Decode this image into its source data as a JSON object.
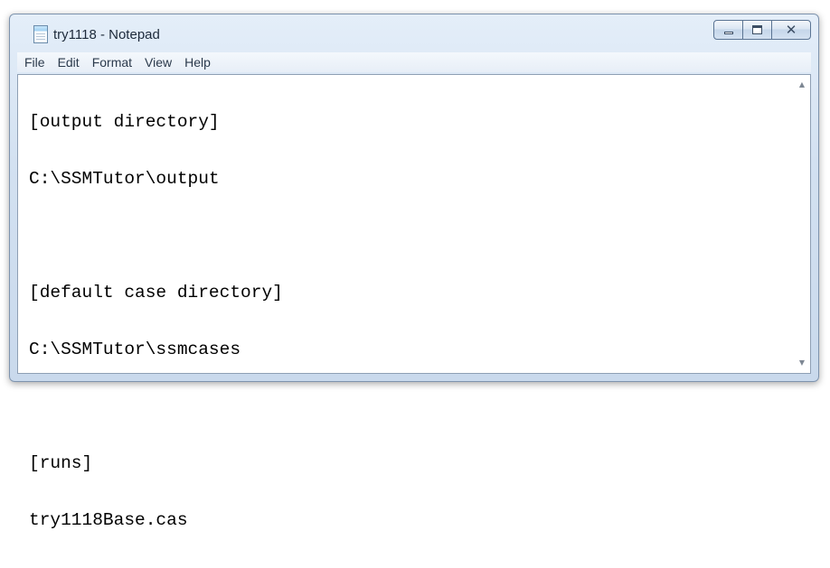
{
  "window": {
    "title": "try1118 - Notepad"
  },
  "caption_buttons": {
    "minimize_icon": "minimize-icon",
    "maximize_icon": "maximize-icon",
    "close_icon": "close-icon",
    "close_glyph": "✕"
  },
  "menu": {
    "items": [
      {
        "label": "File"
      },
      {
        "label": "Edit"
      },
      {
        "label": "Format"
      },
      {
        "label": "View"
      },
      {
        "label": "Help"
      }
    ]
  },
  "document": {
    "lines": [
      "[output directory]",
      "C:\\SSMTutor\\output",
      "",
      "[default case directory]",
      "C:\\SSMTutor\\ssmcases",
      "",
      "[runs]",
      "try1118Base.cas"
    ]
  },
  "scrollbar": {
    "up_glyph": "▲",
    "down_glyph": "▼"
  }
}
